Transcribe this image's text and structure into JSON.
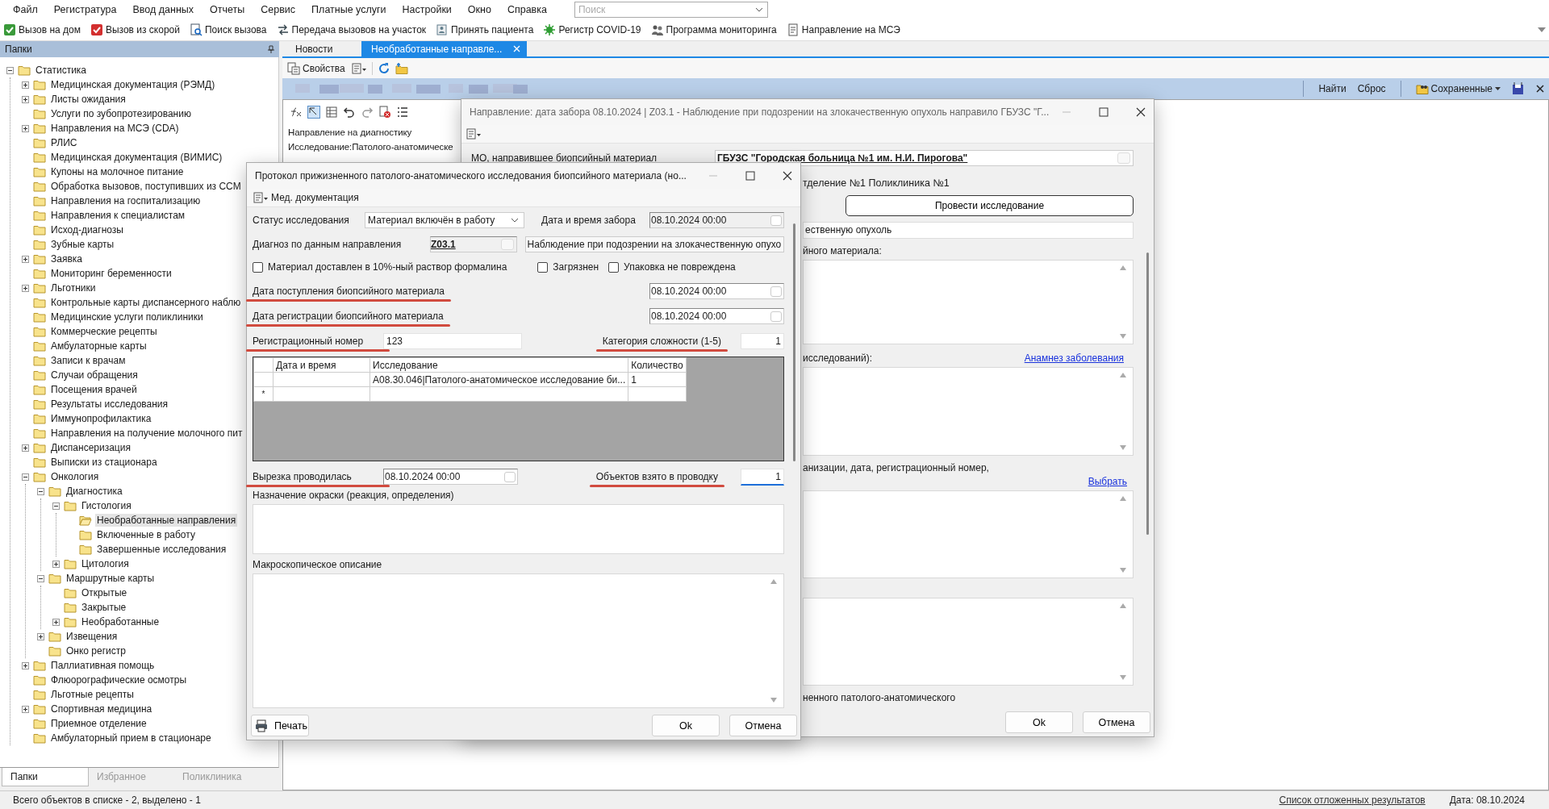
{
  "menu": [
    {
      "label": "Файл"
    },
    {
      "label": "Регистратура"
    },
    {
      "label": "Ввод данных"
    },
    {
      "label": "Отчеты"
    },
    {
      "label": "Сервис"
    },
    {
      "label": "Платные услуги"
    },
    {
      "label": "Настройки"
    },
    {
      "label": "Окно"
    },
    {
      "label": "Справка"
    }
  ],
  "search": {
    "placeholder": "Поиск"
  },
  "toolbar": [
    {
      "label": "Вызов на дом"
    },
    {
      "label": "Вызов из скорой"
    },
    {
      "label": "Поиск вызова"
    },
    {
      "label": "Передача вызовов на участок"
    },
    {
      "label": "Принять пациента"
    },
    {
      "label": "Регистр COVID-19"
    },
    {
      "label": "Программа мониторинга"
    },
    {
      "label": "Направление на МСЭ"
    }
  ],
  "sidebar": {
    "title": "Папки",
    "tree": [
      {
        "label": "Статистика",
        "kind": "branch",
        "expanded": true,
        "selected": false,
        "children": [
          {
            "label": "Медицинская документация (РЭМД)",
            "kind": "branch",
            "expanded": false,
            "selected": false
          },
          {
            "label": "Листы ожидания",
            "kind": "branch",
            "expanded": false,
            "selected": false
          },
          {
            "label": "Услуги по зубопротезированию",
            "kind": "leaf",
            "selected": false
          },
          {
            "label": "Направления на МСЭ (CDA)",
            "kind": "branch",
            "expanded": false,
            "selected": false
          },
          {
            "label": "РЛИС",
            "kind": "leaf",
            "selected": false
          },
          {
            "label": "Медицинская документация (ВИМИС)",
            "kind": "leaf",
            "selected": false
          },
          {
            "label": "Купоны на молочное питание",
            "kind": "leaf",
            "selected": false
          },
          {
            "label": "Обработка вызовов, поступивших из ССМ",
            "kind": "leaf",
            "selected": false
          },
          {
            "label": "Направления на госпитализацию",
            "kind": "leaf",
            "selected": false
          },
          {
            "label": "Направления к специалистам",
            "kind": "leaf",
            "selected": false
          },
          {
            "label": "Исход-диагнозы",
            "kind": "leaf",
            "selected": false
          },
          {
            "label": "Зубные карты",
            "kind": "leaf",
            "selected": false
          },
          {
            "label": "Заявка",
            "kind": "branch",
            "expanded": false,
            "selected": false
          },
          {
            "label": "Мониторинг беременности",
            "kind": "leaf",
            "selected": false
          },
          {
            "label": "Льготники",
            "kind": "branch",
            "expanded": false,
            "selected": false
          },
          {
            "label": "Контрольные карты диспансерного наблю",
            "kind": "leaf",
            "selected": false
          },
          {
            "label": "Медицинские услуги поликлиники",
            "kind": "leaf",
            "selected": false
          },
          {
            "label": "Коммерческие рецепты",
            "kind": "leaf",
            "selected": false
          },
          {
            "label": "Амбулаторные карты",
            "kind": "leaf",
            "selected": false
          },
          {
            "label": "Записи к врачам",
            "kind": "leaf",
            "selected": false
          },
          {
            "label": "Случаи обращения",
            "kind": "leaf",
            "selected": false
          },
          {
            "label": "Посещения врачей",
            "kind": "leaf",
            "selected": false
          },
          {
            "label": "Результаты исследования",
            "kind": "leaf",
            "selected": false
          },
          {
            "label": "Иммунопрофилактика",
            "kind": "leaf",
            "selected": false
          },
          {
            "label": "Направления на получение молочного пит",
            "kind": "leaf",
            "selected": false
          },
          {
            "label": "Диспансеризация",
            "kind": "branch",
            "expanded": false,
            "selected": false
          },
          {
            "label": "Выписки из стационара",
            "kind": "leaf",
            "selected": false
          },
          {
            "label": "Онкология",
            "kind": "branch",
            "expanded": true,
            "selected": false,
            "children": [
              {
                "label": "Диагностика",
                "kind": "branch",
                "expanded": true,
                "selected": false,
                "children": [
                  {
                    "label": "Гистология",
                    "kind": "branch",
                    "expanded": true,
                    "selected": false,
                    "children": [
                      {
                        "label": "Необработанные направления",
                        "kind": "leaf",
                        "selected": true
                      },
                      {
                        "label": "Включенные в работу",
                        "kind": "leaf",
                        "selected": false
                      },
                      {
                        "label": "Завершенные исследования",
                        "kind": "leaf",
                        "selected": false
                      }
                    ]
                  },
                  {
                    "label": "Цитология",
                    "kind": "branch",
                    "expanded": false,
                    "selected": false
                  }
                ]
              },
              {
                "label": "Маршрутные карты",
                "kind": "branch",
                "expanded": true,
                "selected": false,
                "children": [
                  {
                    "label": "Открытые",
                    "kind": "leaf",
                    "selected": false
                  },
                  {
                    "label": "Закрытые",
                    "kind": "leaf",
                    "selected": false
                  },
                  {
                    "label": "Необработанные",
                    "kind": "branch",
                    "expanded": false,
                    "selected": false
                  }
                ]
              },
              {
                "label": "Извещения",
                "kind": "branch",
                "expanded": false,
                "selected": false
              },
              {
                "label": "Онко регистр",
                "kind": "leaf",
                "selected": false
              }
            ]
          },
          {
            "label": "Паллиативная помощь",
            "kind": "branch",
            "expanded": false,
            "selected": false
          },
          {
            "label": "Флюорографические осмотры",
            "kind": "leaf",
            "selected": false
          },
          {
            "label": "Льготные рецепты",
            "kind": "leaf",
            "selected": false
          },
          {
            "label": "Спортивная медицина",
            "kind": "branch",
            "expanded": false,
            "selected": false
          },
          {
            "label": "Приемное отделение",
            "kind": "leaf",
            "selected": false
          },
          {
            "label": "Амбулаторный прием в стационаре",
            "kind": "leaf",
            "selected": false
          }
        ]
      }
    ],
    "tabs": [
      {
        "label": "Папки",
        "selected": true
      },
      {
        "label": "Избранное",
        "selected": false
      },
      {
        "label": "Поликлиника",
        "selected": false
      }
    ]
  },
  "doc_tabs": [
    {
      "label": "Новости",
      "selected": false,
      "closable": false
    },
    {
      "label": "Необработанные направле...",
      "selected": true,
      "closable": true
    }
  ],
  "view_toolbar": {
    "properties": "Свойства"
  },
  "filter_bar": {
    "find": "Найти",
    "reset": "Сброс",
    "saved": "Сохраненные"
  },
  "list": {
    "items": [
      "Направление на диагностику",
      "Исследование:Патолого-анатомическе"
    ]
  },
  "back_dialog": {
    "title": "Направление: дата забора 08.10.2024 | Z03.1 - Наблюдение при подозрении на злокачественную опухоль направило ГБУЗС \"Г...",
    "mo_label": "МО, направившее биопсийный материал",
    "mo_value": "ГБУЗС \"Городская больница №1 им. Н.И. Пирогова\"",
    "department": "тделение №1 Поликлиника №1",
    "action_button": "Провести исследование",
    "diagnosis_tail": "ественную опухоль",
    "material_label": "йного материала:",
    "history_label": "исследований):",
    "history_link": "Анамнез заболевания",
    "org_label": "анизации, дата, регистрационный номер,",
    "choose_link": "Выбрать",
    "protocol_label": "ненного патолого-анатомического",
    "buttons": {
      "ok": "Ok",
      "cancel": "Отмена"
    }
  },
  "front_dialog": {
    "title": "Протокол прижизненного патолого-анатомического исследования биопсийного материала (но...",
    "menu_label": "Мед. документация",
    "status": {
      "label": "Статус исследования",
      "value": "Материал включён в работу"
    },
    "sample_date": {
      "label": "Дата и время забора",
      "value": "08.10.2024 00:00",
      "disabled": true
    },
    "diagnosis": {
      "label": "Диагноз по данным направления",
      "code": "Z03.1",
      "text": "Наблюдение при подозрении на злокачественную опухо"
    },
    "checkboxes": [
      {
        "label": "Материал доставлен в 10%-ный раствор формалина",
        "checked": false
      },
      {
        "label": "Загрязнен",
        "checked": false
      },
      {
        "label": "Упаковка не повреждена",
        "checked": false
      }
    ],
    "received": {
      "label": "Дата поступления биопсийного материала",
      "value": "08.10.2024 00:00",
      "disabled": false,
      "underlined": true
    },
    "registered": {
      "label": "Дата регистрации биопсийного материала",
      "value": "08.10.2024 00:00",
      "disabled": false,
      "underlined": true
    },
    "reg_number": {
      "label": "Регистрационный номер",
      "value": "123",
      "underlined": true
    },
    "complexity": {
      "label": "Категория сложности (1-5)",
      "value": "1",
      "underlined": true
    },
    "grid": {
      "columns": [
        "Дата и время",
        "Исследование",
        "Количество"
      ],
      "rows": [
        {
          "study": "A08.30.046|Патолого-анатомическое исследование би...",
          "quantity": "1"
        }
      ],
      "new_row_marker": "*"
    },
    "cutting": {
      "label": "Вырезка проводилась",
      "value": "08.10.2024 00:00",
      "disabled": false,
      "underlined": true
    },
    "objects": {
      "label": "Объектов взято в проводку",
      "value": "1",
      "underlined": true,
      "focused": true
    },
    "staining": {
      "label": "Назначение окраски (реакция, определения)"
    },
    "macro": {
      "label": "Макроскопическое описание"
    },
    "buttons": {
      "print": "Печать",
      "ok": "Ok",
      "cancel": "Отмена"
    }
  },
  "status_bar": {
    "text": "Всего объектов в списке - 2, выделено - 1",
    "link": "Список отложенных результатов",
    "date": "Дата: 08.10.2024"
  }
}
